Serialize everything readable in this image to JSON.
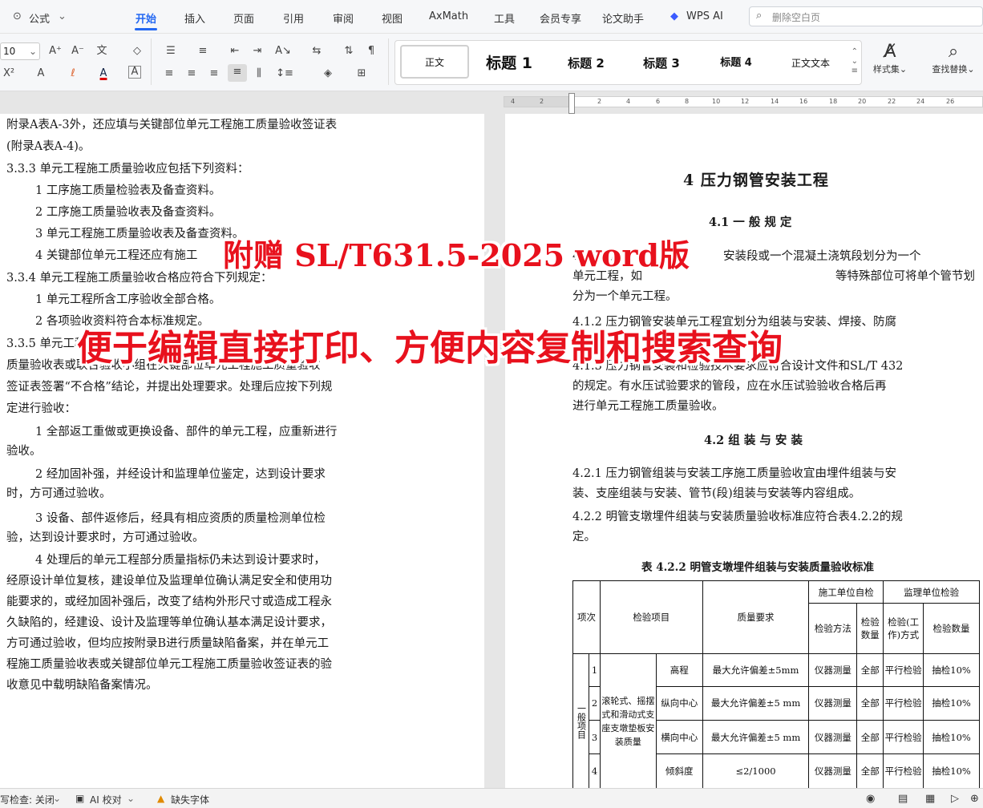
{
  "menubar": {
    "font_label": "公式",
    "tabs": [
      "开始",
      "插入",
      "页面",
      "引用",
      "审阅",
      "视图",
      "AxMath",
      "工具",
      "会员专享",
      "论文助手",
      "WPS AI"
    ],
    "search_placeholder": "删除空白页"
  },
  "ribbon": {
    "font_size": "10",
    "styles": [
      "正文",
      "标题 1",
      "标题 2",
      "标题 3",
      "标题 4",
      "正文文本"
    ],
    "style_set_label": "样式集",
    "find_replace_label": "查找替换"
  },
  "ruler": {
    "ticks": [
      "4",
      "2",
      "2",
      "4",
      "6",
      "8",
      "10",
      "12",
      "14",
      "16",
      "18",
      "20",
      "22",
      "24",
      "26"
    ]
  },
  "left_page": {
    "lines": [
      "附录A表A-3外，还应填与关键部位单元工程施工质量验收签证表",
      "(附录A表A-4)。",
      "3.3.3 单元工程施工质量验收应包括下列资料：",
      "1 工序施工质量检验表及备查资料。",
      "2 工序施工质量验收表及备查资料。",
      "3 单元工程施工质量验收表及备查资料。",
      "4 关键部位单元工程还应有施工",
      "3.3.4 单元工程施工质量验收合格应符合下列规定：",
      "1 单元工程所含工序验收全部合格。",
      "2 各项验收资料符合本标准规定。",
      "3.3.5 单元工程",
      "质量验收表或联合验收小组在关键部位单元工程施工质量验收",
      "签证表签署“不合格”结论，并提出处理要求。处理后应按下列规",
      "定进行验收：",
      "1 全部返工重做或更换设备、部件的单元工程，应重新进行",
      "验收。",
      "2 经加固补强，并经设计和监理单位鉴定，达到设计要求",
      "时，方可通过验收。",
      "3 设备、部件返修后，经具有相应资质的质量检测单位检",
      "验，达到设计要求时，方可通过验收。",
      "4 处理后的单元工程部分质量指标仍未达到设计要求时，",
      "经原设计单位复核，建设单位及监理单位确认满足安全和使用功",
      "能要求的，或经加固补强后，改变了结构外形尺寸或造成工程永",
      "久缺陷的，经建设、设计及监理等单位确认基本满足设计要求，",
      "方可通过验收，但均应按附录B进行质量缺陷备案，并在单元工",
      "程施工质量验收表或关键部位单元工程施工质量验收签证表的验",
      "收意见中载明缺陷备案情况。"
    ]
  },
  "right_page": {
    "chapter_title": "4 压力钢管安装工程",
    "sec_41": "4.1 一 般 规 定",
    "lines_41": [
      "4.1.1 压",
      "安装段或一个混凝土浇筑段划分为一个",
      "单元工程，如",
      "等特殊部位可将单个管节划",
      "分为一个单元工程。",
      "4.1.2 压力钢管安装单元工程宜划分为组装与安装、焊接、防腐",
      "4.1.3 压力钢管安装和检验技术要求应符合设计文件和SL/T 432",
      "的规定。有水压试验要求的管段，应在水压试验验收合格后再",
      "进行单元工程施工质量验收。"
    ],
    "sec_42": "4.2 组 装 与 安 装",
    "lines_42": [
      "4.2.1 压力钢管组装与安装工序施工质量验收宜由埋件组装与安",
      "装、支座组装与安装、管节(段)组装与安装等内容组成。",
      "4.2.2 明管支墩埋件组装与安装质量验收标准应符合表4.2.2的规",
      "定。"
    ],
    "table_caption": "表 4.2.2 明管支墩埋件组装与安装质量验收标准",
    "table": {
      "h_item_no": "项次",
      "h_item": "检验项目",
      "h_quality": "质量要求",
      "h_constructor": "施工单位自检",
      "h_supervisor": "监理单位检验",
      "h_method": "检验方法",
      "h_count": "检验数量",
      "h_sup_method": "检验(工作)方式",
      "h_sup_count": "检验数量",
      "group": "一般项目",
      "subject": "滚轮式、摇摆式和滑动式支座支墩垫板安装质量",
      "rows": [
        {
          "no": "1",
          "item": "高程",
          "req": "最大允许偏差±5mm",
          "method": "仪器测量",
          "count": "全部",
          "sup_method": "平行检验",
          "sup_count": "抽检10%"
        },
        {
          "no": "2",
          "item": "纵向中心",
          "req": "最大允许偏差±5 mm",
          "method": "仪器测量",
          "count": "全部",
          "sup_method": "平行检验",
          "sup_count": "抽检10%"
        },
        {
          "no": "3",
          "item": "横向中心",
          "req": "最大允许偏差±5 mm",
          "method": "仪器测量",
          "count": "全部",
          "sup_method": "平行检验",
          "sup_count": "抽检10%"
        },
        {
          "no": "4",
          "item": "倾斜度",
          "req": "≤2/1000",
          "method": "仪器测量",
          "count": "全部",
          "sup_method": "平行检验",
          "sup_count": "抽检10%"
        }
      ]
    }
  },
  "overlay": {
    "line1": "附赠 SL/T631.5-2025 word版",
    "line2": "便于编辑直接打印、方便内容复制和搜索查询"
  },
  "statusbar": {
    "spell_check": "写检查: 关闭",
    "ai_check": "AI 校对",
    "missing_font": "缺失字体"
  },
  "colors": {
    "accent": "#2468f2",
    "overlay_red": "#e8111d"
  }
}
